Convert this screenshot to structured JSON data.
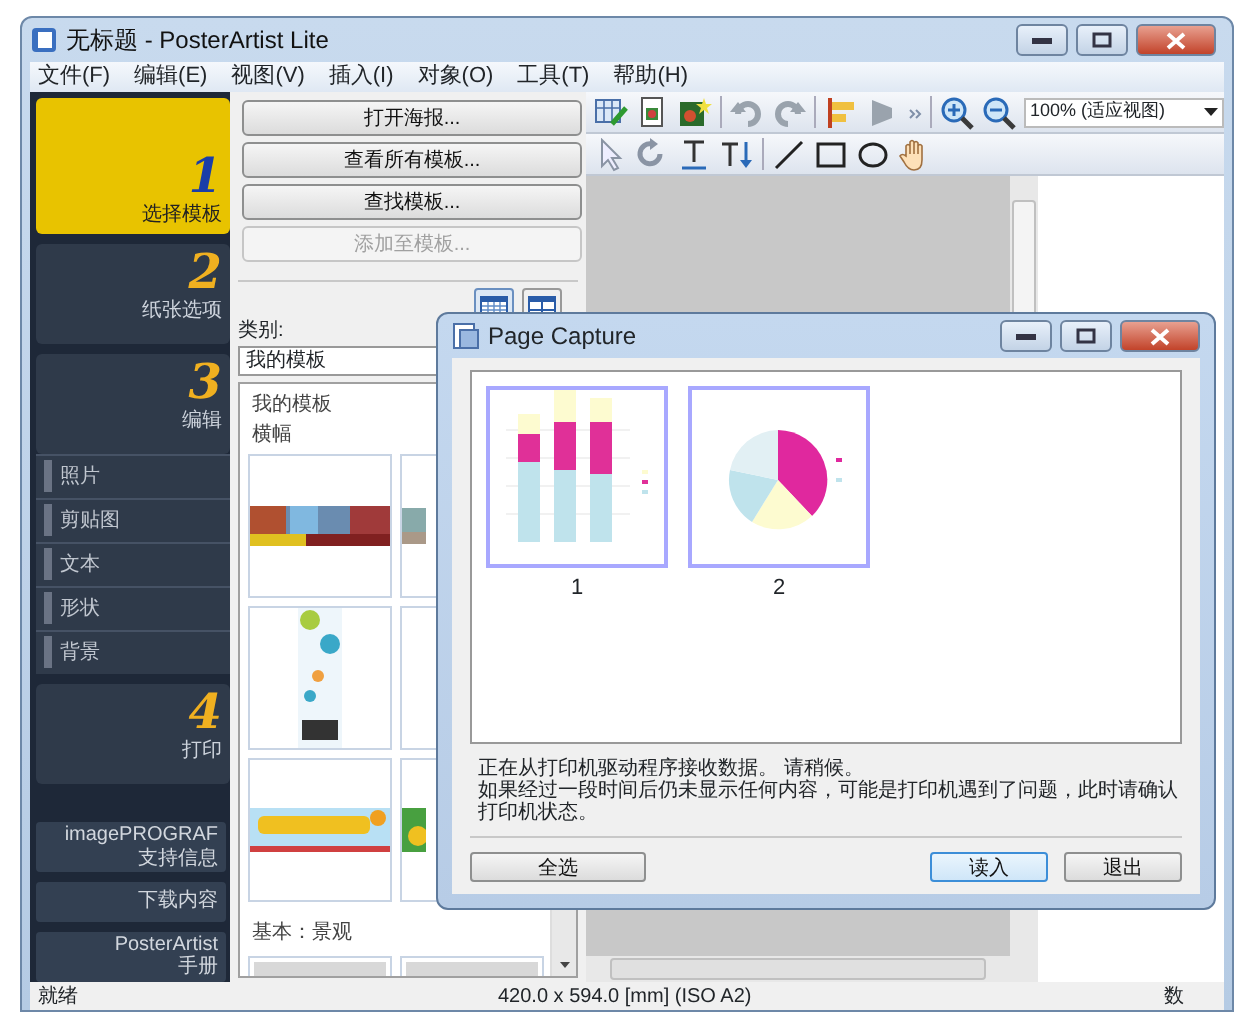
{
  "window": {
    "title": "无标题 - PosterArtist Lite"
  },
  "menu": [
    "文件(F)",
    "编辑(E)",
    "视图(V)",
    "插入(I)",
    "对象(O)",
    "工具(T)",
    "帮助(H)"
  ],
  "steps": [
    {
      "number": "1",
      "label": "选择模板",
      "selected": true
    },
    {
      "number": "2",
      "label": "纸张选项",
      "selected": false
    },
    {
      "number": "3",
      "label": "编辑",
      "selected": false,
      "subitems": [
        "照片",
        "剪贴图",
        "文本",
        "形状",
        "背景"
      ]
    },
    {
      "number": "4",
      "label": "打印",
      "selected": false
    }
  ],
  "links": [
    {
      "lines": [
        "imagePROGRAF",
        "支持信息"
      ]
    },
    {
      "lines": [
        "下载内容"
      ]
    },
    {
      "lines": [
        "PosterArtist",
        "手册"
      ]
    }
  ],
  "template_panel": {
    "buttons": [
      {
        "label": "打开海报...",
        "disabled": false
      },
      {
        "label": "查看所有模板...",
        "disabled": false
      },
      {
        "label": "查找模板...",
        "disabled": false
      },
      {
        "label": "添加至模板...",
        "disabled": true
      }
    ],
    "category_label": "类别:",
    "category": "我的模板",
    "tree": [
      "我的模板",
      "横幅"
    ],
    "group_heading": "基本：景观"
  },
  "toolbar": {
    "zoom": "100% (适应视图)"
  },
  "dialog": {
    "title": "Page Capture",
    "pages": [
      {
        "label": "1",
        "kind": "bar"
      },
      {
        "label": "2",
        "kind": "pie"
      }
    ],
    "message": [
      "正在从打印机驱动程序接收数据。 请稍候。",
      "如果经过一段时间后仍未显示任何内容，可能是打印机遇到了问题，此时请确认打印机状态。"
    ],
    "buttons": [
      {
        "label": "全选",
        "default": false
      },
      {
        "label": "读入",
        "default": true
      },
      {
        "label": "退出",
        "default": false
      }
    ]
  },
  "status_bar": {
    "text": "就绪",
    "size": "420.0 x 594.0 [mm] (ISO A2)",
    "indicator": "数"
  }
}
